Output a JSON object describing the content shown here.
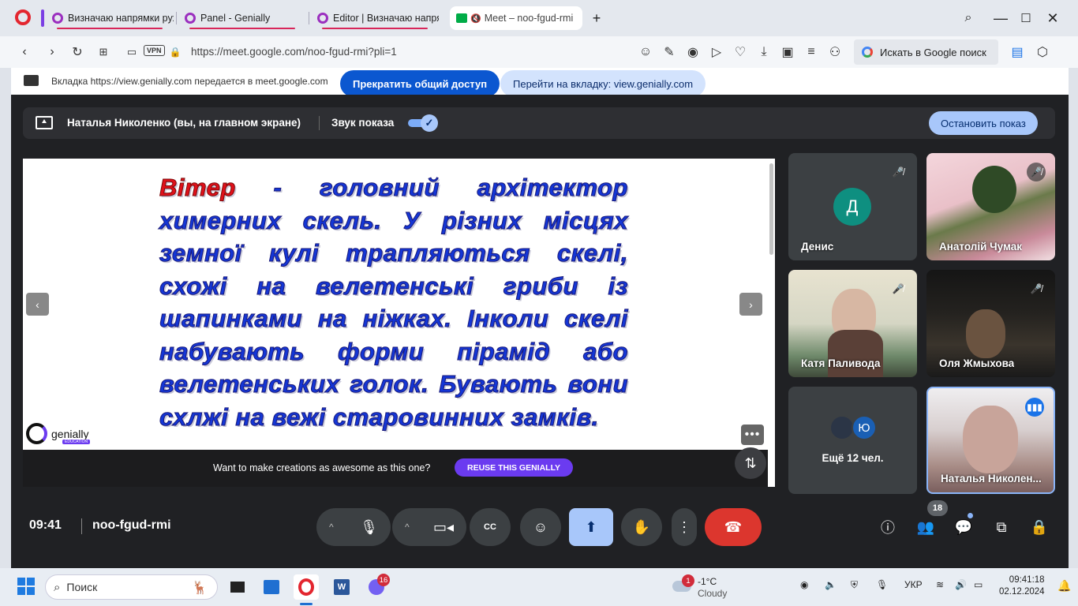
{
  "browser": {
    "tabs": [
      {
        "title": "Визначаю напрямки рухів"
      },
      {
        "title": "Panel - Genially"
      },
      {
        "title": "Editor | Визначаю напрямки"
      },
      {
        "title": "Meet – noo-fgud-rmi"
      }
    ],
    "url": "https://meet.google.com/noo-fgud-rmi?pli=1",
    "vpn_label": "VPN",
    "google_search_label": "Искать в Google поиск"
  },
  "share_banner": {
    "text": "Вкладка https://view.genially.com передается в meet.google.com",
    "stop_label": "Прекратить общий доступ",
    "goto_label": "Перейти на вкладку: view.genially.com"
  },
  "presentation": {
    "presenter": "Наталья Николенко (вы, на главном экране)",
    "sound_label": "Звук показа",
    "stop_label": "Остановить показ",
    "sound_on": true
  },
  "slide": {
    "highlight_word": "Вітер",
    "text": " - головний архітектор химерних скель. У різних місцях земної кулі трапляються скелі, схожі на велетенські гриби із шапинками на ніжках. Інколи скелі набувають форми пірамід або велетенських голок. Бувають вони схлжі на вежі старовинних замків.",
    "logo_text": "genially",
    "logo_sub": "EDUCATION",
    "reuse_text": "Want to make creations as awesome as this one?",
    "reuse_button": "REUSE THIS GENIALLY"
  },
  "participants": [
    {
      "name": "Денис",
      "initial": "Д",
      "muted": true
    },
    {
      "name": "Анатолій Чумак",
      "muted": true
    },
    {
      "name": "Катя Паливода",
      "muted": true
    },
    {
      "name": "Оля Жмыхова",
      "muted": true
    },
    {
      "more_label": "Ещё 12 чел.",
      "initial": "Ю"
    },
    {
      "name": "Наталья Николен...",
      "speaking": true
    }
  ],
  "meeting": {
    "time": "09:41",
    "code": "noo-fgud-rmi",
    "participant_count": "18"
  },
  "colors": {
    "meet_bg": "#202124",
    "accent_blue": "#a8c7fa",
    "end_call": "#dc362e",
    "slide_text_blue": "#1436d6",
    "slide_text_red": "#e0101a",
    "genially_purple": "#6b3bf0"
  },
  "taskbar": {
    "search_placeholder": "Поиск",
    "viber_badge": "16",
    "weather_temp": "-1°C",
    "weather_desc": "Cloudy",
    "weather_badge": "1",
    "lang": "УКР",
    "time": "09:41:18",
    "date": "02.12.2024"
  }
}
